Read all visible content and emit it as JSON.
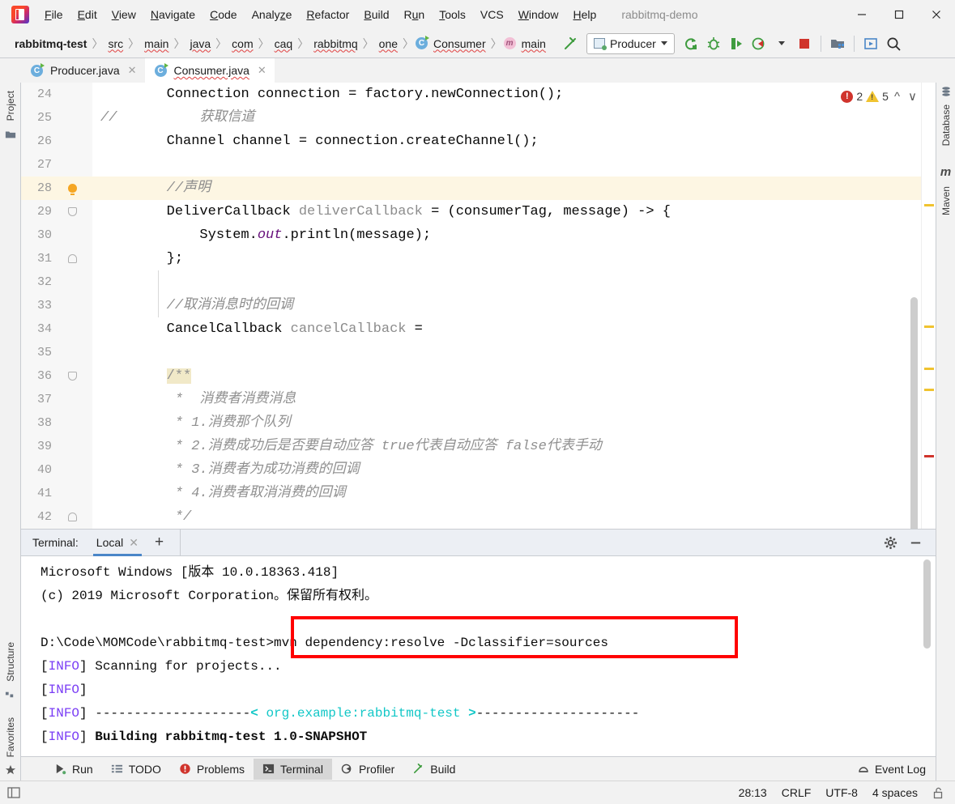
{
  "window": {
    "title": "rabbitmq-demo",
    "controls": {
      "minimize": "minimize-icon",
      "maximize": "maximize-icon",
      "close": "close-icon"
    }
  },
  "menubar": {
    "items": [
      {
        "label": "File",
        "mnemonic": "F"
      },
      {
        "label": "Edit",
        "mnemonic": "E"
      },
      {
        "label": "View",
        "mnemonic": "V"
      },
      {
        "label": "Navigate",
        "mnemonic": "N"
      },
      {
        "label": "Code",
        "mnemonic": "C"
      },
      {
        "label": "Analyze",
        "mnemonic": "z"
      },
      {
        "label": "Refactor",
        "mnemonic": "R"
      },
      {
        "label": "Build",
        "mnemonic": "B"
      },
      {
        "label": "Run",
        "mnemonic": "u"
      },
      {
        "label": "Tools",
        "mnemonic": "T"
      },
      {
        "label": "VCS",
        "mnemonic": ""
      },
      {
        "label": "Window",
        "mnemonic": "W"
      },
      {
        "label": "Help",
        "mnemonic": "H"
      }
    ]
  },
  "navbar": {
    "breadcrumbs": [
      {
        "label": "rabbitmq-test",
        "bold": true,
        "squiggle": false,
        "icon": null
      },
      {
        "label": "src",
        "bold": false,
        "squiggle": true,
        "icon": null
      },
      {
        "label": "main",
        "bold": false,
        "squiggle": true,
        "icon": null
      },
      {
        "label": "java",
        "bold": false,
        "squiggle": true,
        "icon": null
      },
      {
        "label": "com",
        "bold": false,
        "squiggle": true,
        "icon": null
      },
      {
        "label": "caq",
        "bold": false,
        "squiggle": true,
        "icon": null
      },
      {
        "label": "rabbitmq",
        "bold": false,
        "squiggle": true,
        "icon": null
      },
      {
        "label": "one",
        "bold": false,
        "squiggle": true,
        "icon": null
      },
      {
        "label": "Consumer",
        "bold": false,
        "squiggle": true,
        "icon": "class-icon"
      },
      {
        "label": "main",
        "bold": false,
        "squiggle": true,
        "icon": "method-icon"
      }
    ],
    "run_configuration": "Producer",
    "toolbar_icons": [
      "build-hammer-icon",
      "rerun-icon",
      "debug-icon",
      "run-with-coverage-icon",
      "profile-icon",
      "stop-icon",
      "project-structure-icon",
      "select-run-icon",
      "search-icon"
    ]
  },
  "tabs": [
    {
      "label": "Producer.java",
      "active": false,
      "icon": "java-class-icon"
    },
    {
      "label": "Consumer.java",
      "active": true,
      "icon": "java-class-icon"
    }
  ],
  "left_tool_window": {
    "items": [
      "Project",
      "Structure",
      "Favorites"
    ]
  },
  "right_tool_window": {
    "items": [
      "Database",
      "Maven"
    ]
  },
  "editor": {
    "inspection": {
      "errors": "2",
      "warnings": "5"
    },
    "lines": [
      {
        "num": "24",
        "marker": "",
        "tokens": [
          {
            "t": "        ",
            "c": "plain"
          },
          {
            "t": "Connection",
            "c": "plain"
          },
          {
            "t": " connection = factory.newConnection();",
            "c": "plain"
          }
        ],
        "hl": false
      },
      {
        "num": "25",
        "marker": "",
        "tokens": [
          {
            "t": "//",
            "c": "cmt-slash"
          },
          {
            "t": "          ",
            "c": "plain"
          },
          {
            "t": "获取信道",
            "c": "cmt"
          }
        ],
        "hl": false
      },
      {
        "num": "26",
        "marker": "",
        "tokens": [
          {
            "t": "        Channel channel = connection.createChannel();",
            "c": "plain"
          }
        ],
        "hl": false
      },
      {
        "num": "27",
        "marker": "",
        "tokens": [
          {
            "t": "",
            "c": "plain"
          }
        ],
        "hl": false
      },
      {
        "num": "28",
        "marker": "bulb",
        "tokens": [
          {
            "t": "        //声明",
            "c": "cmt"
          }
        ],
        "hl": true
      },
      {
        "num": "29",
        "marker": "fold-start",
        "tokens": [
          {
            "t": "        ",
            "c": "plain"
          },
          {
            "t": "DeliverCallback",
            "c": "plain"
          },
          {
            "t": " deliverCallback",
            "c": "fld"
          },
          {
            "t": " = (consumerTag, message) -> {",
            "c": "plain"
          }
        ],
        "hl": false
      },
      {
        "num": "30",
        "marker": "",
        "tokens": [
          {
            "t": "            System.",
            "c": "plain"
          },
          {
            "t": "out",
            "c": "stat"
          },
          {
            "t": ".println(message);",
            "c": "plain"
          }
        ],
        "hl": false
      },
      {
        "num": "31",
        "marker": "fold-end",
        "tokens": [
          {
            "t": "        };",
            "c": "plain"
          }
        ],
        "hl": false
      },
      {
        "num": "32",
        "marker": "",
        "tokens": [
          {
            "t": "",
            "c": "plain"
          }
        ],
        "hl": false
      },
      {
        "num": "33",
        "marker": "",
        "tokens": [
          {
            "t": "        //取消消息时的回调",
            "c": "cmt"
          }
        ],
        "hl": false
      },
      {
        "num": "34",
        "marker": "",
        "tokens": [
          {
            "t": "        ",
            "c": "plain"
          },
          {
            "t": "CancelCallback",
            "c": "plain"
          },
          {
            "t": " cancelCallback",
            "c": "fld"
          },
          {
            "t": " =",
            "c": "plain"
          }
        ],
        "hl": false
      },
      {
        "num": "35",
        "marker": "",
        "tokens": [
          {
            "t": "",
            "c": "plain"
          }
        ],
        "hl": false
      },
      {
        "num": "36",
        "marker": "fold-start",
        "tokens": [
          {
            "t": "        ",
            "c": "plain"
          },
          {
            "t": "/**",
            "c": "jdoc-hl"
          }
        ],
        "hl": false
      },
      {
        "num": "37",
        "marker": "",
        "tokens": [
          {
            "t": "         *  消费者消费消息",
            "c": "jdoc"
          }
        ],
        "hl": false
      },
      {
        "num": "38",
        "marker": "",
        "tokens": [
          {
            "t": "         * 1.消费那个队列",
            "c": "jdoc"
          }
        ],
        "hl": false
      },
      {
        "num": "39",
        "marker": "",
        "tokens": [
          {
            "t": "         * 2.消费成功后是否要自动应答 true代表自动应答 false代表手动",
            "c": "jdoc"
          }
        ],
        "hl": false
      },
      {
        "num": "40",
        "marker": "",
        "tokens": [
          {
            "t": "         * 3.消费者为成功消费的回调",
            "c": "jdoc"
          }
        ],
        "hl": false
      },
      {
        "num": "41",
        "marker": "",
        "tokens": [
          {
            "t": "         * 4.消费者取消消费的回调",
            "c": "jdoc"
          }
        ],
        "hl": false
      },
      {
        "num": "42",
        "marker": "fold-end",
        "tokens": [
          {
            "t": "         */",
            "c": "jdoc"
          }
        ],
        "hl": false
      }
    ]
  },
  "terminal_panel": {
    "label": "Terminal:",
    "tab": "Local",
    "add_tab": "+",
    "settings_icon": "gear-icon",
    "hide_icon": "minimize-icon",
    "lines": [
      {
        "segments": [
          {
            "t": "Microsoft Windows [版本 10.0.18363.418]",
            "c": "plain"
          }
        ]
      },
      {
        "segments": [
          {
            "t": "(c) 2019 Microsoft Corporation。保留所有权利。",
            "c": "plain"
          }
        ]
      },
      {
        "segments": [
          {
            "t": "",
            "c": "plain"
          }
        ]
      },
      {
        "segments": [
          {
            "t": "D:\\Code\\MOMCode\\rabbitmq-test>mvn dependency:resolve -Dclassifier=sources",
            "c": "plain"
          }
        ]
      },
      {
        "segments": [
          {
            "t": "[",
            "c": "plain"
          },
          {
            "t": "INFO",
            "c": "info"
          },
          {
            "t": "] Scanning for projects...",
            "c": "plain"
          }
        ]
      },
      {
        "segments": [
          {
            "t": "[",
            "c": "plain"
          },
          {
            "t": "INFO",
            "c": "info"
          },
          {
            "t": "] ",
            "c": "plain"
          }
        ]
      },
      {
        "segments": [
          {
            "t": "[",
            "c": "plain"
          },
          {
            "t": "INFO",
            "c": "info"
          },
          {
            "t": "] ",
            "c": "plain"
          },
          {
            "t": "--------------------",
            "c": "plain"
          },
          {
            "t": "< ",
            "c": "cyan-bold"
          },
          {
            "t": "org.example:rabbitmq-test",
            "c": "cyan"
          },
          {
            "t": " >",
            "c": "cyan-bold"
          },
          {
            "t": "---------------------",
            "c": "plain"
          }
        ]
      },
      {
        "segments": [
          {
            "t": "[",
            "c": "plain"
          },
          {
            "t": "INFO",
            "c": "info"
          },
          {
            "t": "] ",
            "c": "plain"
          },
          {
            "t": "Building rabbitmq-test 1.0-SNAPSHOT",
            "c": "bold"
          }
        ]
      }
    ],
    "highlight_command": "mvn dependency:resolve -Dclassifier=sources",
    "highlight_color": "#ff0000"
  },
  "bottom_bar": {
    "tabs": [
      {
        "label": "Run",
        "icon": "run-icon",
        "active": false
      },
      {
        "label": "TODO",
        "icon": "todo-icon",
        "active": false
      },
      {
        "label": "Problems",
        "icon": "problems-icon",
        "active": false
      },
      {
        "label": "Terminal",
        "icon": "terminal-icon",
        "active": true
      },
      {
        "label": "Profiler",
        "icon": "profiler-icon",
        "active": false
      },
      {
        "label": "Build",
        "icon": "build-hammer-icon",
        "active": false
      }
    ],
    "event_log": "Event Log"
  },
  "status_bar": {
    "caret_position": "28:13",
    "line_separator": "CRLF",
    "encoding": "UTF-8",
    "indent": "4 spaces",
    "lock_icon": "unlocked-icon"
  }
}
